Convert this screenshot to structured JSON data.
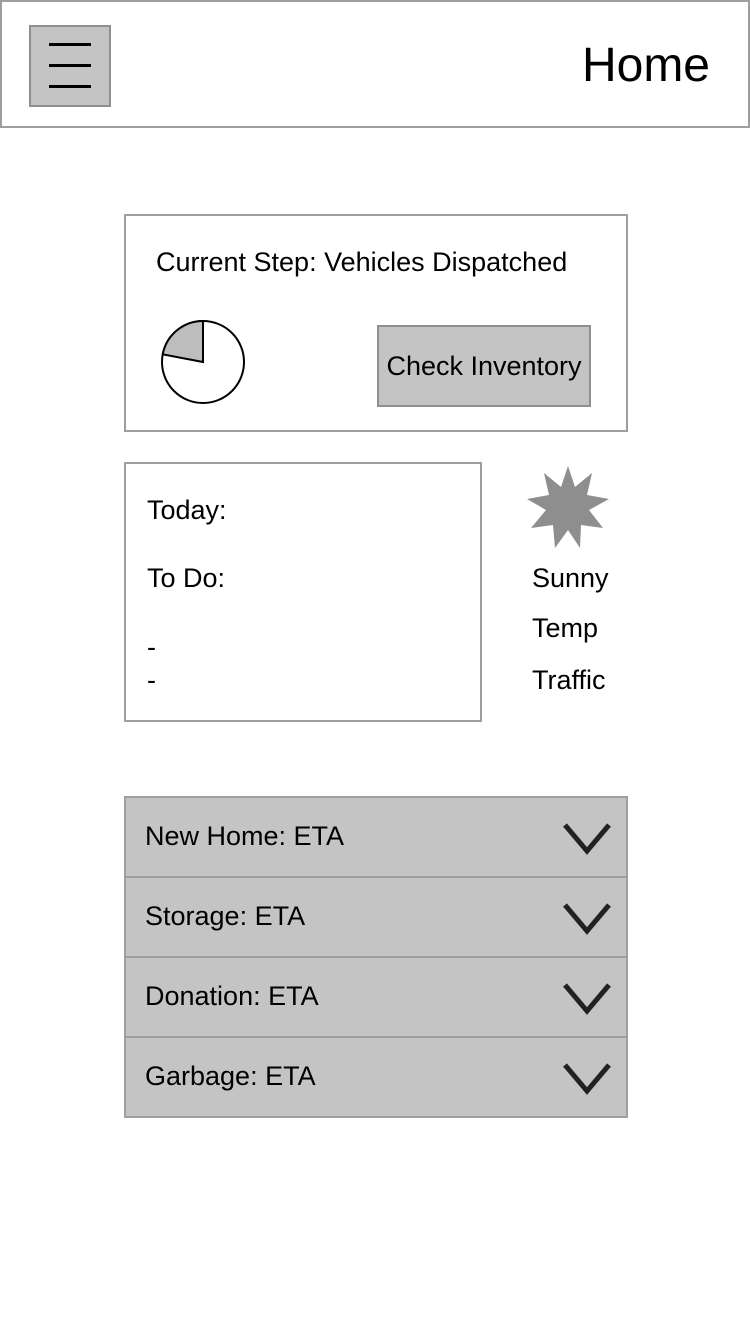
{
  "header": {
    "title": "Home",
    "menu_icon": "hamburger-menu-icon"
  },
  "status_card": {
    "current_step": "Current Step: Vehicles Dispatched",
    "progress_fraction": 0.22,
    "button_label": "Check Inventory"
  },
  "todo_card": {
    "today_label": "Today:",
    "todo_label": "To Do:",
    "items": [
      "-",
      "-"
    ]
  },
  "weather": {
    "icon": "sun-icon",
    "condition": "Sunny",
    "temp_label": "Temp",
    "traffic_label": "Traffic"
  },
  "eta_list": [
    {
      "label": "New Home: ETA"
    },
    {
      "label": "Storage: ETA"
    },
    {
      "label": "Donation: ETA"
    },
    {
      "label": "Garbage: ETA"
    }
  ],
  "colors": {
    "control_fill": "#c4c4c4",
    "border": "#9e9e9e",
    "icon_gray": "#8e8e8e"
  }
}
